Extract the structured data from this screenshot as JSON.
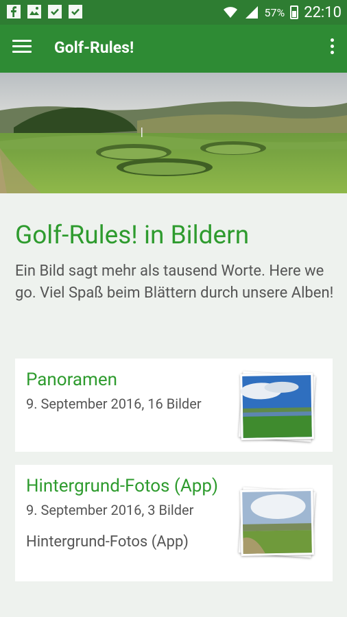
{
  "status_bar": {
    "battery": "57%",
    "time": "22:10",
    "icons": [
      "facebook-icon",
      "image-notification-icon",
      "briefcase-icon",
      "briefcase-check-icon",
      "wifi-icon",
      "signal-icon",
      "battery-icon"
    ]
  },
  "app_bar": {
    "title": "Golf-Rules!",
    "menu_icon": "hamburger-icon",
    "overflow_icon": "more-vert-icon"
  },
  "intro": {
    "heading": "Golf-Rules! in Bildern",
    "text": "Ein Bild sagt mehr als tausend Worte. Here we go. Viel Spaß beim Blättern durch unsere Alben!"
  },
  "albums": [
    {
      "title": "Panoramen",
      "meta": "9. September 2016, 16 Bilder"
    },
    {
      "title": "Hintergrund-Fotos (App)",
      "meta": "9. September 2016, 3 Bilder",
      "description": "Hintergrund-Fotos (App)"
    }
  ],
  "colors": {
    "status_bar": "#2e7d32",
    "app_bar": "#2e8b34",
    "accent": "#2e9b2e",
    "background": "#eef2ee"
  }
}
